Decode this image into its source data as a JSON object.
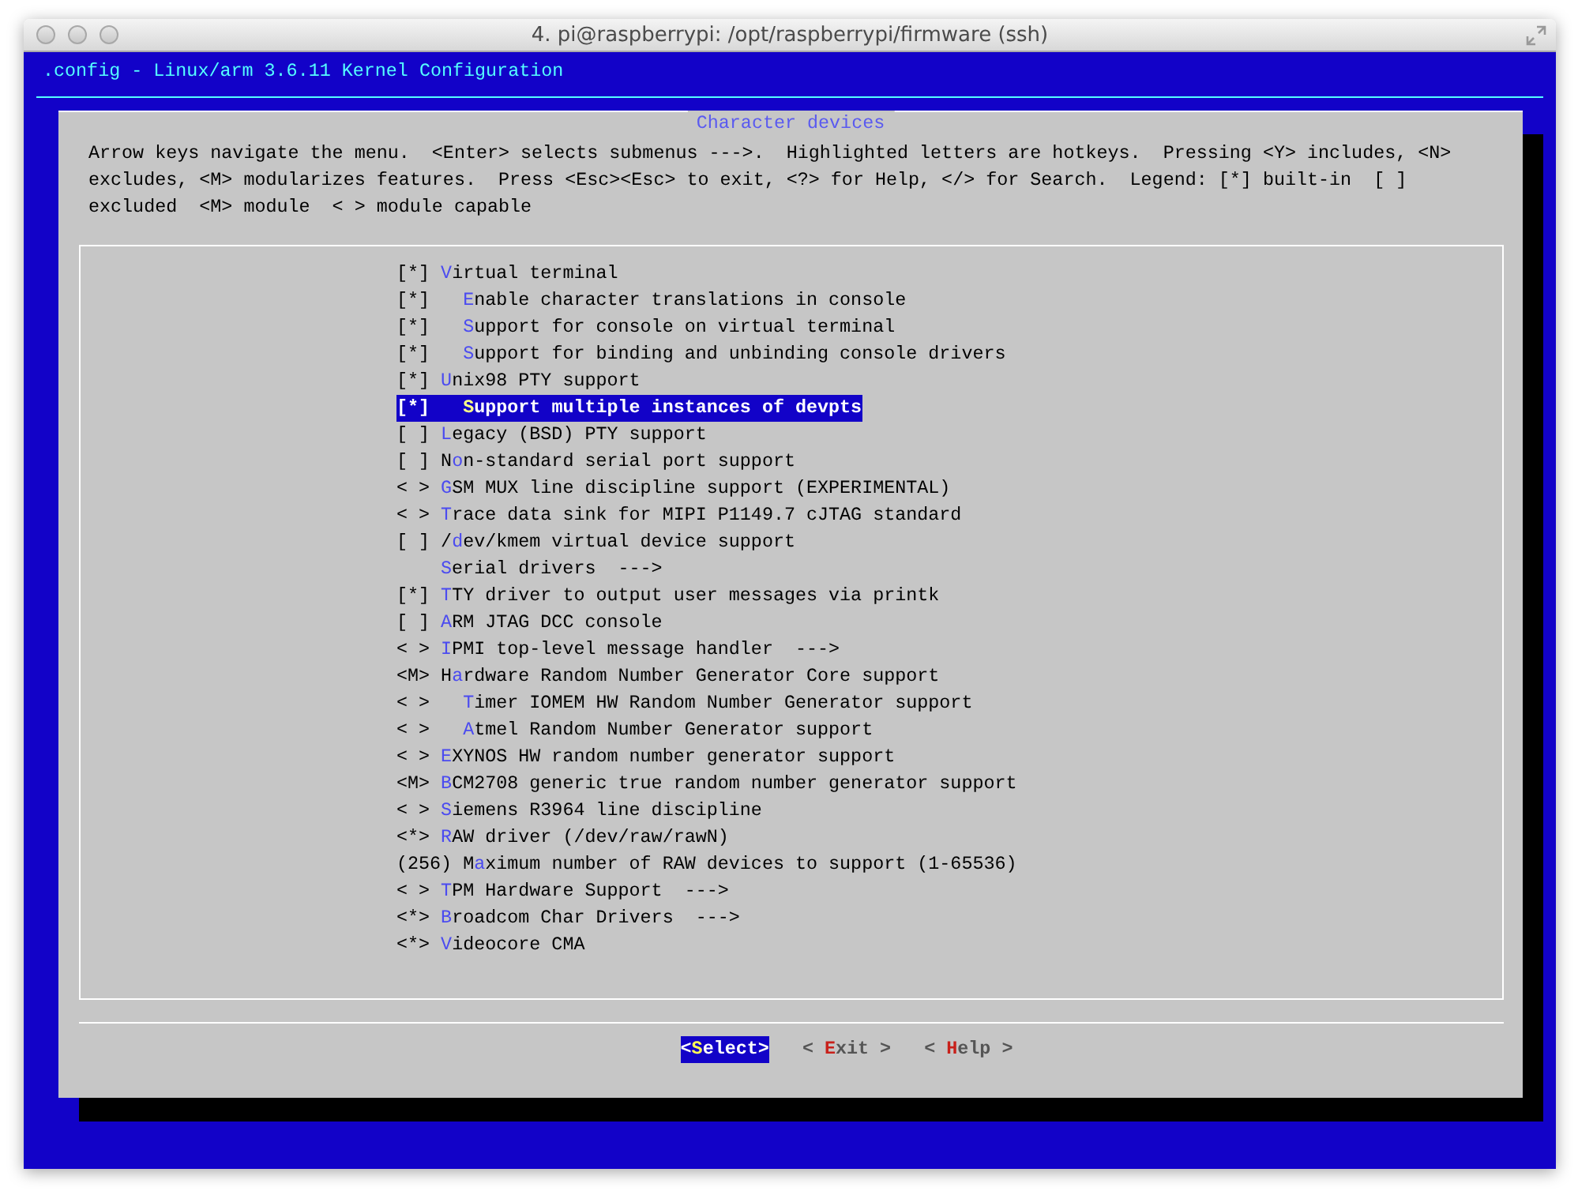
{
  "window": {
    "title": "4. pi@raspberrypi: /opt/raspberrypi/firmware (ssh)"
  },
  "header": ".config - Linux/arm 3.6.11 Kernel Configuration",
  "dialog": {
    "title": "Character devices",
    "help_lines": [
      "Arrow keys navigate the menu.  <Enter> selects submenus --->.  Highlighted letters are hotkeys.  Pressing <Y> includes, <N>",
      "excludes, <M> modularizes features.  Press <Esc><Esc> to exit, <?> for Help, </> for Search.  Legend: [*] built-in  [ ]",
      "excluded  <M> module  < > module capable"
    ],
    "items": [
      {
        "prefix": "[*]",
        "hotkey": "V",
        "rest": "irtual terminal",
        "selected": false,
        "children": [
          {
            "prefix": "[*]",
            "hotkey": "E",
            "rest": "nable character translations in console",
            "selected": false
          },
          {
            "prefix": "[*]",
            "hotkey": "S",
            "rest": "upport for console on virtual terminal",
            "selected": false
          },
          {
            "prefix": "[*]",
            "hotkey": "S",
            "rest": "upport for binding and unbinding console drivers",
            "selected": false
          }
        ]
      },
      {
        "prefix": "[*]",
        "hotkey": "U",
        "rest": "nix98 PTY support",
        "selected": false,
        "children": [
          {
            "prefix": "[*]",
            "hotkey": "S",
            "rest": "upport multiple instances of devpts",
            "selected": true
          }
        ]
      },
      {
        "prefix": "[ ]",
        "hotkey": "L",
        "rest": "egacy (BSD) PTY support",
        "selected": false
      },
      {
        "prefix": "[ ]",
        "lead": "N",
        "hotkey": "o",
        "rest": "n-standard serial port support",
        "selected": false
      },
      {
        "prefix": "< >",
        "hotkey": "G",
        "rest": "SM MUX line discipline support (EXPERIMENTAL)",
        "selected": false
      },
      {
        "prefix": "< >",
        "hotkey": "T",
        "rest": "race data sink for MIPI P1149.7 cJTAG standard",
        "selected": false
      },
      {
        "prefix": "[ ]",
        "lead": "/",
        "hotkey": "d",
        "rest": "ev/kmem virtual device support",
        "selected": false
      },
      {
        "hotkey": "S",
        "rest": "erial drivers  --->",
        "selected": false
      },
      {
        "prefix": "[*]",
        "hotkey": "T",
        "rest": "TY driver to output user messages via printk",
        "selected": false
      },
      {
        "prefix": "[ ]",
        "hotkey": "A",
        "rest": "RM JTAG DCC console",
        "selected": false
      },
      {
        "prefix": "< >",
        "hotkey": "I",
        "rest": "PMI top-level message handler  --->",
        "selected": false
      },
      {
        "prefix": "<M>",
        "lead": "H",
        "hotkey": "a",
        "rest": "rdware Random Number Generator Core support",
        "selected": false,
        "children": [
          {
            "prefix": "< >",
            "hotkey": "T",
            "rest": "imer IOMEM HW Random Number Generator support",
            "selected": false
          },
          {
            "prefix": "< >",
            "hotkey": "A",
            "rest": "tmel Random Number Generator support",
            "selected": false
          }
        ]
      },
      {
        "prefix": "< >",
        "hotkey": "E",
        "rest": "XYNOS HW random number generator support",
        "selected": false
      },
      {
        "prefix": "<M>",
        "hotkey": "B",
        "rest": "CM2708 generic true random number generator support",
        "selected": false
      },
      {
        "prefix": "< >",
        "hotkey": "S",
        "rest": "iemens R3964 line discipline",
        "selected": false
      },
      {
        "prefix": "<*>",
        "hotkey": "R",
        "rest": "AW driver (/dev/raw/rawN)",
        "selected": false
      },
      {
        "prefix": "(256)",
        "lead": "M",
        "hotkey": "a",
        "rest": "ximum number of RAW devices to support (1-65536)",
        "selected": false
      },
      {
        "prefix": "< >",
        "hotkey": "T",
        "rest": "PM Hardware Support  --->",
        "selected": false
      },
      {
        "prefix": "<*>",
        "hotkey": "B",
        "rest": "roadcom Char Drivers  --->",
        "selected": false
      },
      {
        "prefix": "<*>",
        "hotkey": "V",
        "rest": "ideocore CMA",
        "selected": false
      }
    ],
    "buttons": [
      {
        "lead": "<",
        "hotkey": "S",
        "rest": "elect>",
        "selected": true
      },
      {
        "lead": "< ",
        "hotkey": "E",
        "rest": "xit >",
        "selected": false
      },
      {
        "lead": "< ",
        "hotkey": "H",
        "rest": "elp >",
        "selected": false
      }
    ]
  }
}
